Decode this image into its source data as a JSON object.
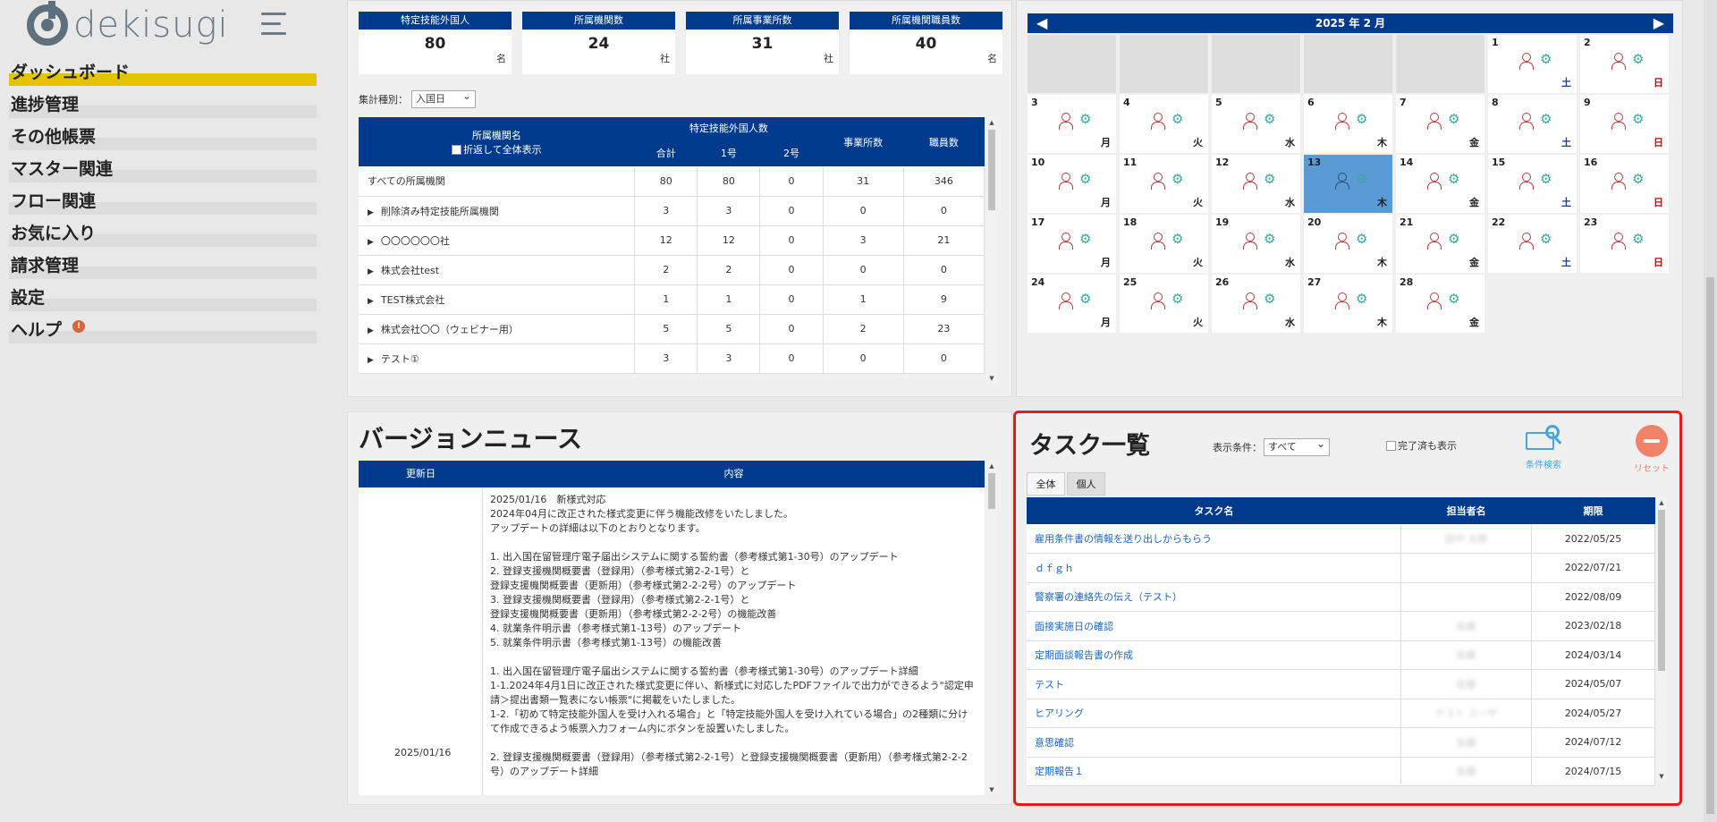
{
  "brand": {
    "name": "dekisugi"
  },
  "sidebar": {
    "items": [
      {
        "label": "ダッシュボード",
        "active": true
      },
      {
        "label": "進捗管理"
      },
      {
        "label": "その他帳票"
      },
      {
        "label": "マスター関連"
      },
      {
        "label": "フロー関連"
      },
      {
        "label": "お気に入り"
      },
      {
        "label": "請求管理"
      },
      {
        "label": "設定"
      },
      {
        "label": "ヘルプ",
        "badge": "!"
      }
    ]
  },
  "stats": [
    {
      "label": "特定技能外国人",
      "value": "80",
      "unit": "名"
    },
    {
      "label": "所属機関数",
      "value": "24",
      "unit": "社"
    },
    {
      "label": "所属事業所数",
      "value": "31",
      "unit": "社"
    },
    {
      "label": "所属機関職員数",
      "value": "40",
      "unit": "名"
    }
  ],
  "aggregation": {
    "label": "集計種別：",
    "selected": "入国日"
  },
  "org_table": {
    "headers": {
      "org_name": "所属機関名",
      "wrap_toggle": "折返して全体表示",
      "foreigners": "特定技能外国人数",
      "total": "合計",
      "type1": "1号",
      "type2": "2号",
      "offices": "事業所数",
      "staff": "職員数"
    },
    "rows": [
      {
        "name": "すべての所属機関",
        "expand": false,
        "total": "80",
        "type1": "80",
        "type2": "0",
        "offices": "31",
        "staff": "346"
      },
      {
        "name": "削除済み特定技能所属機関",
        "expand": true,
        "total": "3",
        "type1": "3",
        "type2": "0",
        "offices": "0",
        "staff": "0"
      },
      {
        "name": "〇〇〇〇〇〇社",
        "expand": true,
        "total": "12",
        "type1": "12",
        "type2": "0",
        "offices": "3",
        "staff": "21"
      },
      {
        "name": "株式会社test",
        "expand": true,
        "total": "2",
        "type1": "2",
        "type2": "0",
        "offices": "0",
        "staff": "0"
      },
      {
        "name": "TEST株式会社",
        "expand": true,
        "total": "1",
        "type1": "1",
        "type2": "0",
        "offices": "1",
        "staff": "9"
      },
      {
        "name": "株式会社〇〇（ウェビナー用）",
        "expand": true,
        "total": "5",
        "type1": "5",
        "type2": "0",
        "offices": "2",
        "staff": "23"
      },
      {
        "name": "テスト①",
        "expand": true,
        "total": "3",
        "type1": "3",
        "type2": "0",
        "offices": "0",
        "staff": "0"
      }
    ]
  },
  "calendar": {
    "title": "2025 年 2 月",
    "prev": "◀",
    "next": "▶",
    "leading_empty": 5,
    "today": 13,
    "days": [
      {
        "d": "1",
        "w": "土",
        "t": "sat"
      },
      {
        "d": "2",
        "w": "日",
        "t": "sun"
      },
      {
        "d": "3",
        "w": "月"
      },
      {
        "d": "4",
        "w": "火"
      },
      {
        "d": "5",
        "w": "水"
      },
      {
        "d": "6",
        "w": "木"
      },
      {
        "d": "7",
        "w": "金"
      },
      {
        "d": "8",
        "w": "土",
        "t": "sat"
      },
      {
        "d": "9",
        "w": "日",
        "t": "sun"
      },
      {
        "d": "10",
        "w": "月"
      },
      {
        "d": "11",
        "w": "火"
      },
      {
        "d": "12",
        "w": "水"
      },
      {
        "d": "13",
        "w": "木"
      },
      {
        "d": "14",
        "w": "金"
      },
      {
        "d": "15",
        "w": "土",
        "t": "sat"
      },
      {
        "d": "16",
        "w": "日",
        "t": "sun"
      },
      {
        "d": "17",
        "w": "月"
      },
      {
        "d": "18",
        "w": "火"
      },
      {
        "d": "19",
        "w": "水"
      },
      {
        "d": "20",
        "w": "木"
      },
      {
        "d": "21",
        "w": "金"
      },
      {
        "d": "22",
        "w": "土",
        "t": "sat"
      },
      {
        "d": "23",
        "w": "日",
        "t": "sun"
      },
      {
        "d": "24",
        "w": "月"
      },
      {
        "d": "25",
        "w": "火"
      },
      {
        "d": "26",
        "w": "水"
      },
      {
        "d": "27",
        "w": "木"
      },
      {
        "d": "28",
        "w": "金"
      }
    ]
  },
  "news": {
    "title": "バージョンニュース",
    "headers": {
      "date": "更新日",
      "content": "内容"
    },
    "date": "2025/01/16",
    "content": "2025/01/16　新様式対応\n2024年04月に改正された様式変更に伴う機能改修をいたしました。\nアップデートの詳細は以下のとおりとなります。\n\n1. 出入国在留管理庁電子届出システムに関する誓約書（参考様式第1-30号）のアップデート\n2. 登録支援機関概要書（登録用）（参考様式第2-2-1号）と\n登録支援機関概要書（更新用）（参考様式第2-2-2号）のアップデート\n3. 登録支援機関概要書（登録用）（参考様式第2-2-1号）と\n登録支援機関概要書（更新用）（参考様式第2-2-2号）の機能改善\n4. 就業条件明示書（参考様式第1-13号）のアップデート\n5. 就業条件明示書（参考様式第1-13号）の機能改善\n\n1. 出入国在留管理庁電子届出システムに関する誓約書（参考様式第1-30号）のアップデート詳細\n1-1.2024年4月1日に改正された様式変更に伴い、新様式に対応したPDFファイルで出力ができるよう\"認定申請＞提出書類一覧表にない帳票\"に掲載をいたしました。\n1-2.「初めて特定技能外国人を受け入れる場合」と「特定技能外国人を受け入れている場合」の2種類に分けて作成できるよう帳票入力フォーム内にボタンを設置いたしました。\n\n2. 登録支援機関概要書（登録用）（参考様式第2-2-1号）と登録支援機関概要書（更新用）（参考様式第2-2-2号）のアップデート詳細"
  },
  "tasks": {
    "title": "タスク一覧",
    "condition_label": "表示条件：",
    "condition_value": "すべて",
    "show_done_label": "完了済も表示",
    "search_label": "条件検索",
    "reset_label": "リセット",
    "tabs": [
      "全体",
      "個人"
    ],
    "headers": {
      "name": "タスク名",
      "person": "担当者名",
      "deadline": "期限"
    },
    "rows": [
      {
        "name": "雇用条件書の情報を送り出しからもらう",
        "person": "田中 太郎",
        "deadline": "2022/05/25"
      },
      {
        "name": "ｄｆｇｈ",
        "person": "",
        "deadline": "2022/07/21"
      },
      {
        "name": "警察署の連絡先の伝え（テスト）",
        "person": "",
        "deadline": "2022/08/09"
      },
      {
        "name": "面接実施日の確認",
        "person": "佐藤",
        "deadline": "2023/02/18"
      },
      {
        "name": "定期面談報告書の作成",
        "person": "佐藤",
        "deadline": "2024/03/14"
      },
      {
        "name": "テスト",
        "person": "佐藤",
        "deadline": "2024/05/07"
      },
      {
        "name": "ヒアリング",
        "person": "テスト ユーザ",
        "deadline": "2024/05/27"
      },
      {
        "name": "意思確認",
        "person": "佐藤",
        "deadline": "2024/07/12"
      },
      {
        "name": "定期報告１",
        "person": "佐藤",
        "deadline": "2024/07/15"
      }
    ]
  }
}
